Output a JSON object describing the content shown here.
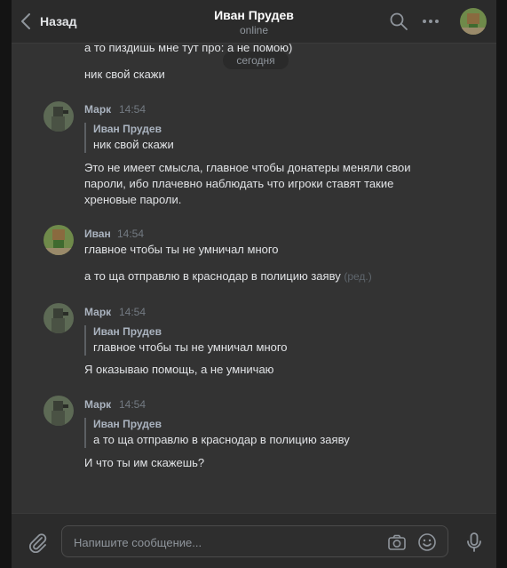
{
  "header": {
    "back_label": "Назад",
    "title": "Иван Прудев",
    "status": "online"
  },
  "history": {
    "top_partial_text": "а то пиздишь мне тут про: а не помою)",
    "top_partial_text_2": "ник свой скажи",
    "date_separator": "сегодня",
    "messages": [
      {
        "author": "Марк",
        "time": "14:54",
        "reply_author": "Иван Прудев",
        "reply_text": "ник свой скажи",
        "lines": [
          "Это не имеет смысла, главное чтобы донатеры меняли свои",
          "пароли, ибо плачевно наблюдать что игроки ставят такие",
          "хреновые пароли."
        ]
      },
      {
        "author": "Иван",
        "time": "14:54",
        "lines": [
          "главное чтобы ты не умничал много",
          "а то ща отправлю в краснодар в полицию заяву"
        ],
        "edited_label": "(ред.)"
      },
      {
        "author": "Марк",
        "time": "14:54",
        "reply_author": "Иван Прудев",
        "reply_text": "главное чтобы ты не умничал много",
        "lines": [
          "Я оказываю помощь, а не умничаю"
        ]
      },
      {
        "author": "Марк",
        "time": "14:54",
        "reply_author": "Иван Прудев",
        "reply_text": "а то ща отправлю в краснодар в полицию заяву",
        "lines": [
          "И что ты им скажешь?"
        ]
      }
    ]
  },
  "composer": {
    "placeholder": "Напишите сообщение..."
  },
  "colors": {
    "background": "#333333",
    "header": "#2b2b2b",
    "text": "#e1e3e6",
    "author": "#aab3bf",
    "muted": "#737a82"
  },
  "icons": [
    "chevron-left-icon",
    "search-icon",
    "more-icon",
    "paperclip-icon",
    "camera-icon",
    "smile-icon",
    "microphone-icon"
  ]
}
